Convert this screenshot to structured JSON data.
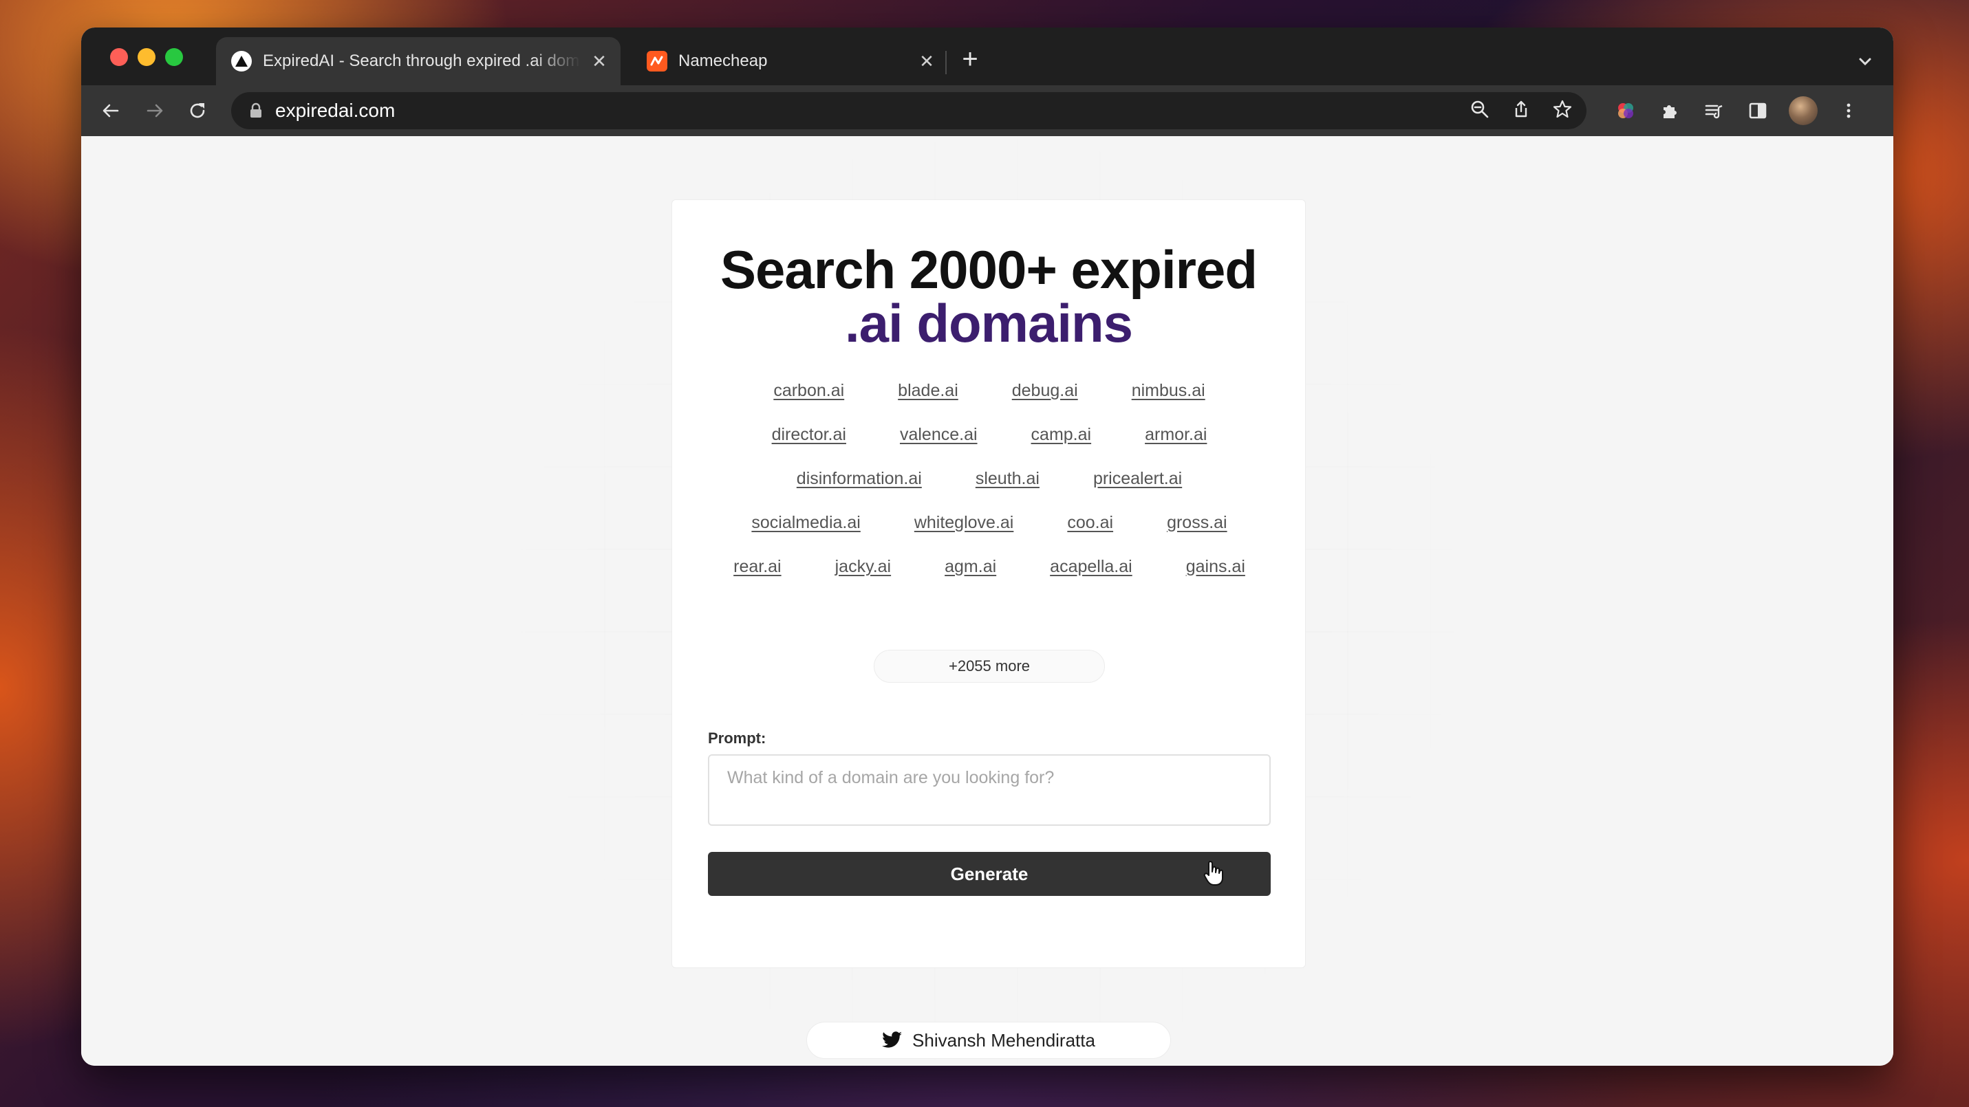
{
  "browser": {
    "tabs": [
      {
        "title": "ExpiredAI - Search through expired .ai domains",
        "active": true
      },
      {
        "title": "Namecheap",
        "active": false
      }
    ],
    "url": "expiredai.com"
  },
  "page": {
    "headline_line1": "Search 2000+ expired",
    "headline_line2": ".ai domains",
    "accent_color": "#3c1e6e",
    "domains": [
      "carbon.ai",
      "blade.ai",
      "debug.ai",
      "nimbus.ai",
      "director.ai",
      "valence.ai",
      "camp.ai",
      "armor.ai",
      "disinformation.ai",
      "sleuth.ai",
      "pricealert.ai",
      "socialmedia.ai",
      "whiteglove.ai",
      "coo.ai",
      "gross.ai",
      "rear.ai",
      "jacky.ai",
      "agm.ai",
      "acapella.ai",
      "gains.ai"
    ],
    "more_label": "+2055 more",
    "prompt_label": "Prompt:",
    "prompt_placeholder": "What kind of a domain are you looking for?",
    "prompt_value": "",
    "generate_label": "Generate",
    "credit_name": "Shivansh Mehendiratta",
    "credit_icon": "twitter-icon"
  }
}
